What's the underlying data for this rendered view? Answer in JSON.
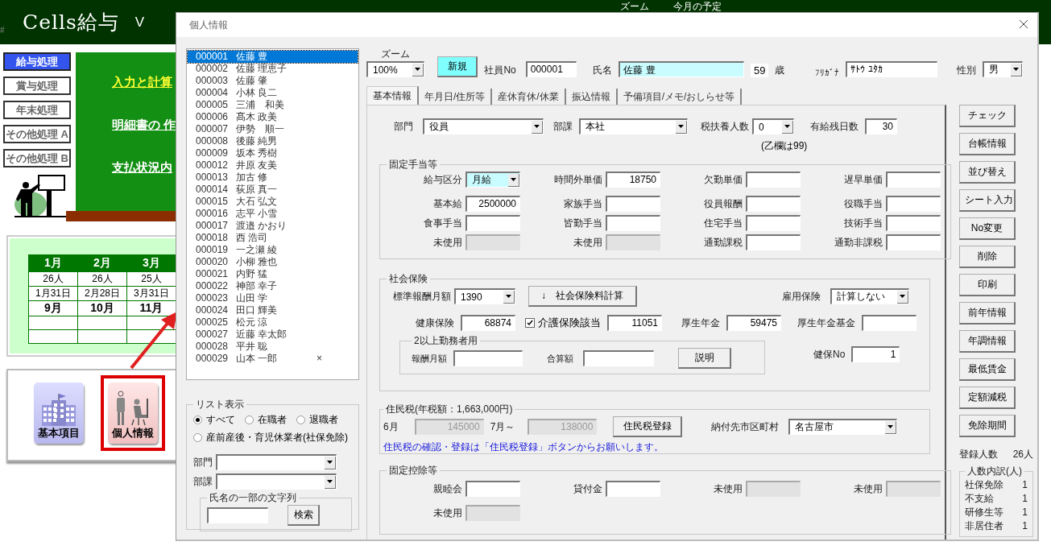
{
  "app": {
    "hash": "#",
    "title": "Cells給与",
    "version": "V",
    "top_menu": [
      "ズーム",
      "今月の予定"
    ],
    "nav": [
      {
        "label": "給与処理",
        "selected": true
      },
      {
        "label": "賞与処理",
        "selected": false
      },
      {
        "label": "年末処理",
        "selected": false
      },
      {
        "label": "その他処理 A",
        "selected": false
      },
      {
        "label": "その他処理 B",
        "selected": false
      }
    ],
    "board_links": [
      {
        "label": "入力と計算",
        "kind": "highlight"
      },
      {
        "label": "明細書の 作",
        "kind": "plain"
      },
      {
        "label": "支払状況内",
        "kind": "plain"
      }
    ],
    "calendar": {
      "columns": [
        "1月",
        "2月",
        "3月"
      ],
      "rows": [
        {
          "kind": "count",
          "cells": [
            "26人",
            "26人",
            "25人"
          ]
        },
        {
          "kind": "date",
          "cells": [
            "1月31日",
            "2月28日",
            "3月31日"
          ]
        },
        {
          "kind": "month",
          "cells": [
            "9月",
            "10月",
            "11月"
          ]
        }
      ]
    },
    "launchers": [
      {
        "label": "基本項目",
        "kind": "building",
        "selected": false
      },
      {
        "label": "個人情報",
        "kind": "people",
        "selected": true
      }
    ]
  },
  "dialog": {
    "title": "個人情報",
    "employee_list": [
      {
        "id": "000001",
        "name": "佐藤 豊",
        "selected": true
      },
      {
        "id": "000002",
        "name": "佐藤 理恵子",
        "selected": false
      },
      {
        "id": "000003",
        "name": "佐藤 肇",
        "selected": false
      },
      {
        "id": "000004",
        "name": "小林 良二",
        "selected": false
      },
      {
        "id": "000005",
        "name": "三浦　和美",
        "selected": false
      },
      {
        "id": "000006",
        "name": "髙木 政美",
        "selected": false
      },
      {
        "id": "000007",
        "name": "伊勢　順一",
        "selected": false
      },
      {
        "id": "000008",
        "name": "後藤 純男",
        "selected": false
      },
      {
        "id": "000009",
        "name": "坂本 秀樹",
        "selected": false
      },
      {
        "id": "000012",
        "name": "井原 友美",
        "selected": false
      },
      {
        "id": "000013",
        "name": "加古 修",
        "selected": false
      },
      {
        "id": "000014",
        "name": "荻原 真一",
        "selected": false
      },
      {
        "id": "000015",
        "name": "大石 弘文",
        "selected": false
      },
      {
        "id": "000016",
        "name": "志平 小雪",
        "selected": false
      },
      {
        "id": "000017",
        "name": "渡邉 かおり",
        "selected": false
      },
      {
        "id": "000018",
        "name": "西 浩司",
        "selected": false
      },
      {
        "id": "000019",
        "name": "一之瀬 綾",
        "selected": false
      },
      {
        "id": "000020",
        "name": "小柳 雅也",
        "selected": false
      },
      {
        "id": "000021",
        "name": "内野 猛",
        "selected": false
      },
      {
        "id": "000022",
        "name": "神部 幸子",
        "selected": false
      },
      {
        "id": "000023",
        "name": "山田 学",
        "selected": false
      },
      {
        "id": "000024",
        "name": "田口 輝美",
        "selected": false
      },
      {
        "id": "000025",
        "name": "松元 涼",
        "selected": false
      },
      {
        "id": "000027",
        "name": "近藤 幸太郎",
        "selected": false
      },
      {
        "id": "000028",
        "name": "平井 聡",
        "selected": false
      },
      {
        "id": "000029",
        "name": "山本 一郎",
        "selected": false,
        "flag": "×"
      }
    ],
    "list_filter": {
      "title": "リスト表示",
      "options": [
        {
          "label": "すべて",
          "selected": true
        },
        {
          "label": "在職者",
          "selected": false
        },
        {
          "label": "退職者",
          "selected": false
        },
        {
          "label": "産前産後・育児休業者(社保免除)",
          "selected": false
        }
      ],
      "department_label": "部門",
      "section_label": "部課",
      "name_search": {
        "title": "氏名の一部の文字列",
        "button": "検索"
      }
    },
    "header": {
      "zoom_label": "ズーム",
      "zoom": "100%",
      "new_button": "新規",
      "employee_no_label": "社員No",
      "employee_no": "000001",
      "name_label": "氏名",
      "name": "佐藤 豊",
      "age": "59",
      "age_unit": "歳",
      "kana_label": "ﾌﾘｶﾞﾅ",
      "kana": "ｻﾄｳ ﾕﾀｶ",
      "gender_label": "性別",
      "gender": "男"
    },
    "tabs": [
      {
        "label": "基本情報",
        "selected": true
      },
      {
        "label": "年月日/住所等",
        "selected": false
      },
      {
        "label": "産休育休/休業",
        "selected": false
      },
      {
        "label": "振込情報",
        "selected": false
      },
      {
        "label": "予備項目/メモ/おしらせ等",
        "selected": false
      }
    ],
    "basic": {
      "department_label": "部門",
      "department": "役員",
      "section_label": "部課",
      "section": "本社",
      "dependents_label": "税扶養人数",
      "dependents": "0",
      "dependents_note": "(乙欄は99)",
      "paid_leave_label": "有給残日数",
      "paid_leave": "30"
    },
    "allowances": {
      "title": "固定手当等",
      "fields": [
        {
          "label": "給与区分",
          "value": "月給",
          "kind": "combo",
          "disabled": false,
          "highlighted": true
        },
        {
          "label": "時間外単価",
          "value": "18750",
          "kind": "number",
          "disabled": false,
          "highlighted": false
        },
        {
          "label": "欠勤単価",
          "kind": "number",
          "disabled": false,
          "highlighted": false
        },
        {
          "label": "遅早単価",
          "kind": "number",
          "disabled": false,
          "highlighted": false
        },
        {
          "label": "基本給",
          "value": "2500000",
          "kind": "number",
          "disabled": false,
          "highlighted": false
        },
        {
          "label": "家族手当",
          "kind": "number",
          "disabled": false,
          "highlighted": false
        },
        {
          "label": "役員報酬",
          "kind": "number",
          "disabled": false,
          "highlighted": false
        },
        {
          "label": "役職手当",
          "kind": "number",
          "disabled": false,
          "highlighted": false
        },
        {
          "label": "食事手当",
          "kind": "number",
          "disabled": false,
          "highlighted": false
        },
        {
          "label": "皆勤手当",
          "kind": "number",
          "disabled": false,
          "highlighted": false
        },
        {
          "label": "住宅手当",
          "kind": "number",
          "disabled": false,
          "highlighted": false
        },
        {
          "label": "技術手当",
          "kind": "number",
          "disabled": false,
          "highlighted": false
        },
        {
          "label": "未使用",
          "kind": "number",
          "disabled": true,
          "highlighted": false
        },
        {
          "label": "未使用",
          "kind": "number",
          "disabled": true,
          "highlighted": false
        },
        {
          "label": "通勤課税",
          "kind": "number",
          "disabled": false,
          "highlighted": false
        },
        {
          "label": "通勤非課税",
          "kind": "number",
          "disabled": false,
          "highlighted": false
        }
      ]
    },
    "social_insurance": {
      "title": "社会保険",
      "standard_label": "標準報酬月額",
      "standard": "1390",
      "calc_button": "↓　社会保険料計算",
      "employment_label": "雇用保険",
      "employment": "計算しない",
      "health_label": "健康保険",
      "health": "68874",
      "care_label": "介護保険該当",
      "care_checked": true,
      "care": "11051",
      "pension_label": "厚生年金",
      "pension": "59475",
      "fund_label": "厚生年金基金",
      "multi": {
        "title": "2以上勤務者用",
        "monthly_label": "報酬月額",
        "total_label": "合算額",
        "help_button": "説明"
      },
      "insurer_no_label": "健保No",
      "insurer_no": "1"
    },
    "resident_tax": {
      "title": "住民税(年税額：1,663,000円)",
      "june_label": "6月",
      "june": {
        "value": "145000",
        "disabled": true
      },
      "july_label": "7月～",
      "july": {
        "value": "138000",
        "disabled": true
      },
      "register_button": "住民税登録",
      "city_label": "納付先市区町村",
      "city": "名古屋市",
      "note": "住民税の確認・登録は「住民税登録」ボタンからお願いします。"
    },
    "deductions": {
      "title": "固定控除等",
      "fields": [
        {
          "label": "親睦会",
          "disabled": false
        },
        {
          "label": "貸付金",
          "disabled": false
        },
        {
          "label": "未使用",
          "disabled": true
        },
        {
          "label": "未使用",
          "disabled": true
        },
        {
          "label": "未使用",
          "disabled": true
        }
      ]
    },
    "actions": [
      "チェック",
      "台帳情報",
      "並び替え",
      "シート入力",
      "No変更",
      "削除",
      "印刷",
      "前年情報",
      "年調情報",
      "最低賃金",
      "定額減税",
      "免除期間"
    ],
    "registered": {
      "label": "登録人数",
      "value": "26人"
    },
    "breakdown": {
      "title": "人数内訳(人)",
      "rows": [
        {
          "label": "社保免除",
          "value": "1"
        },
        {
          "label": "不支給",
          "value": "1"
        },
        {
          "label": "研修生等",
          "value": "1"
        },
        {
          "label": "非居住者",
          "value": "1"
        }
      ]
    }
  }
}
